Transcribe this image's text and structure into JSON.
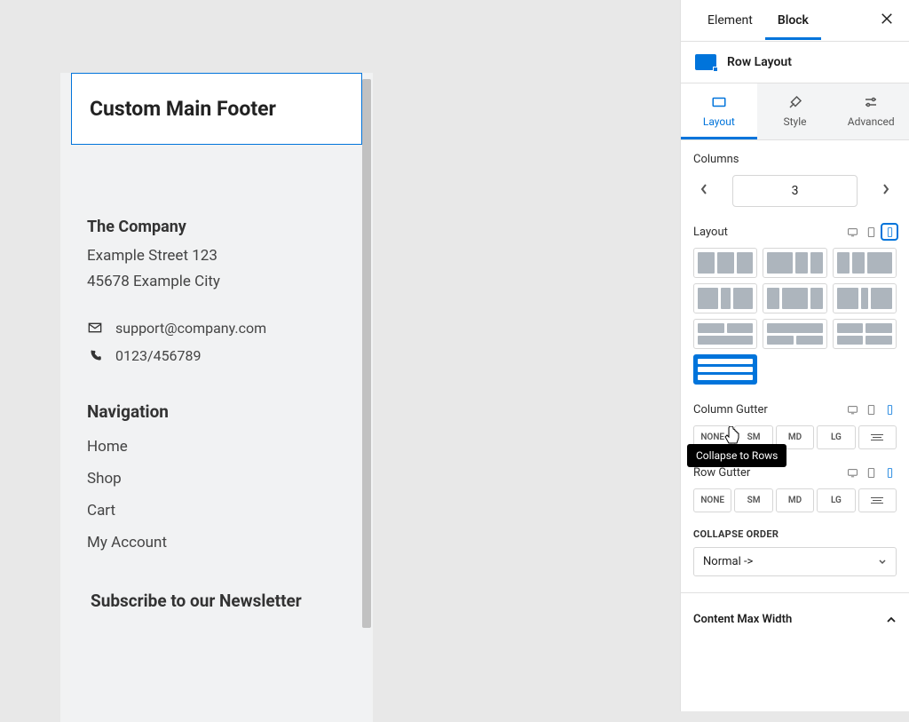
{
  "tabs": {
    "element": "Element",
    "block": "Block"
  },
  "block": {
    "name": "Row Layout"
  },
  "modes": {
    "layout": "Layout",
    "style": "Style",
    "advanced": "Advanced"
  },
  "columns": {
    "label": "Columns",
    "value": "3"
  },
  "layout": {
    "label": "Layout",
    "tooltip": "Collapse to Rows"
  },
  "column_gutter": {
    "label": "Column Gutter",
    "none": "NONE",
    "sm": "SM",
    "md": "MD",
    "lg": "LG"
  },
  "row_gutter": {
    "label": "Row Gutter",
    "none": "NONE",
    "sm": "SM",
    "md": "MD",
    "lg": "LG"
  },
  "collapse_order": {
    "label": "COLLAPSE ORDER",
    "value": "Normal ->"
  },
  "content_max_width": "Content Max Width",
  "preview": {
    "title": "Custom Main Footer",
    "company": {
      "heading": "The Company",
      "street": "Example Street 123",
      "city": "45678 Example City"
    },
    "contact": {
      "email": "support@company.com",
      "phone": "0123/456789"
    },
    "nav": {
      "heading": "Navigation",
      "items": [
        "Home",
        "Shop",
        "Cart",
        "My Account"
      ]
    },
    "newsletter": {
      "heading": "Subscribe to our Newsletter"
    }
  }
}
